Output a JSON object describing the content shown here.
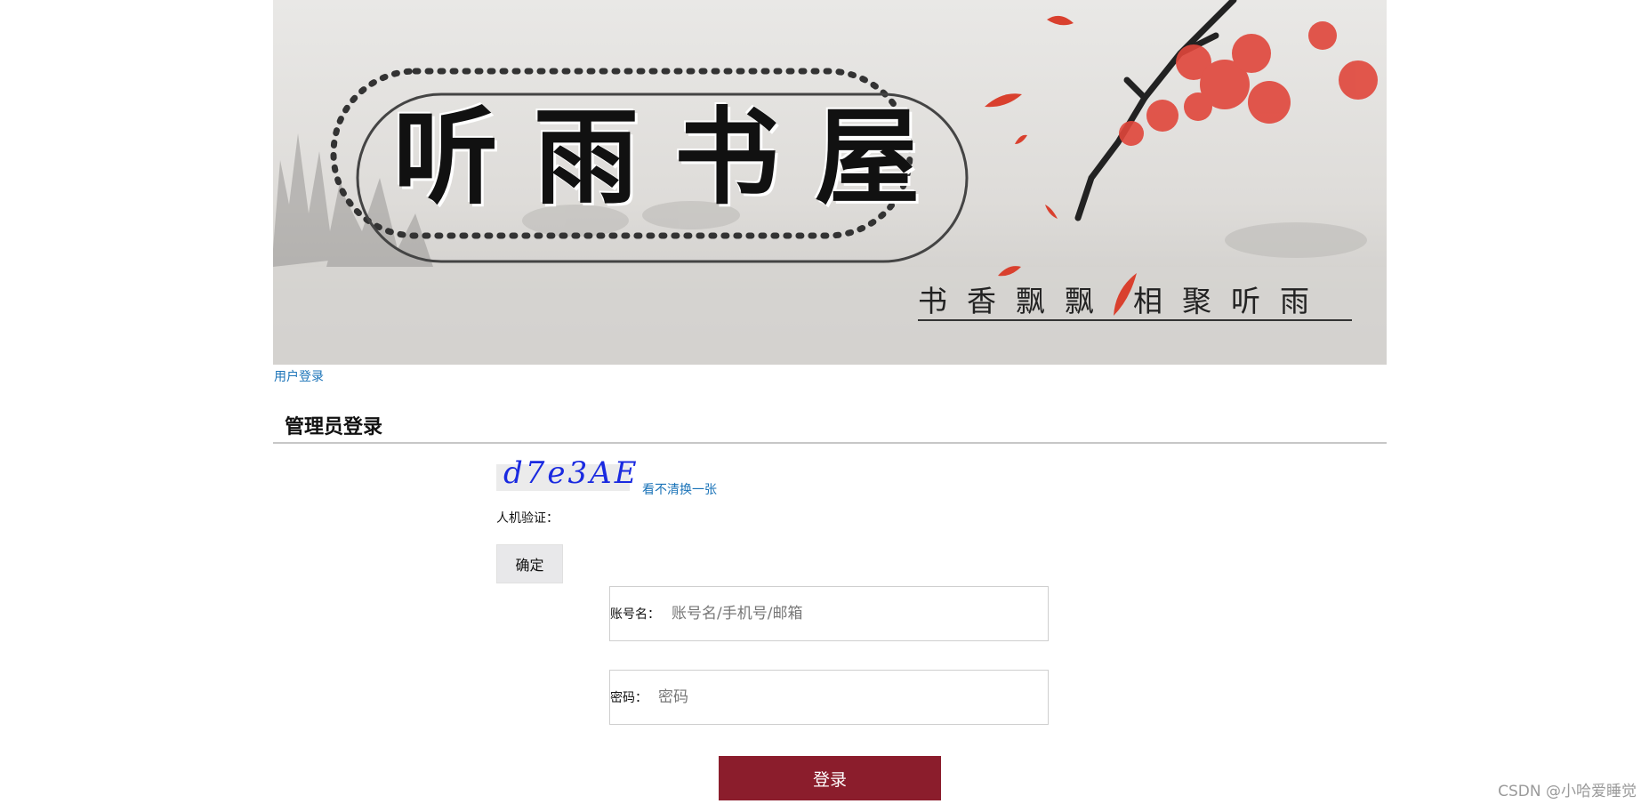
{
  "banner": {
    "title": "听雨书屋",
    "subtitle_left": "书香飘飘",
    "subtitle_right": "相聚听雨"
  },
  "nav": {
    "user_login": "用户登录"
  },
  "section": {
    "title": "管理员登录"
  },
  "captcha": {
    "code": "d7e3AE",
    "refresh_label": "看不清换一张",
    "verify_label": "人机验证：",
    "confirm_label": "确定"
  },
  "form": {
    "account_label": "账号名：",
    "account_placeholder": "账号名/手机号/邮箱",
    "password_label": "密码：",
    "password_placeholder": "密码",
    "login_label": "登录"
  },
  "watermark": "CSDN @小哈爱睡觉",
  "colors": {
    "login_button": "#8b1d2c",
    "link": "#1a73b8",
    "captcha_text": "#1a2ae0"
  }
}
